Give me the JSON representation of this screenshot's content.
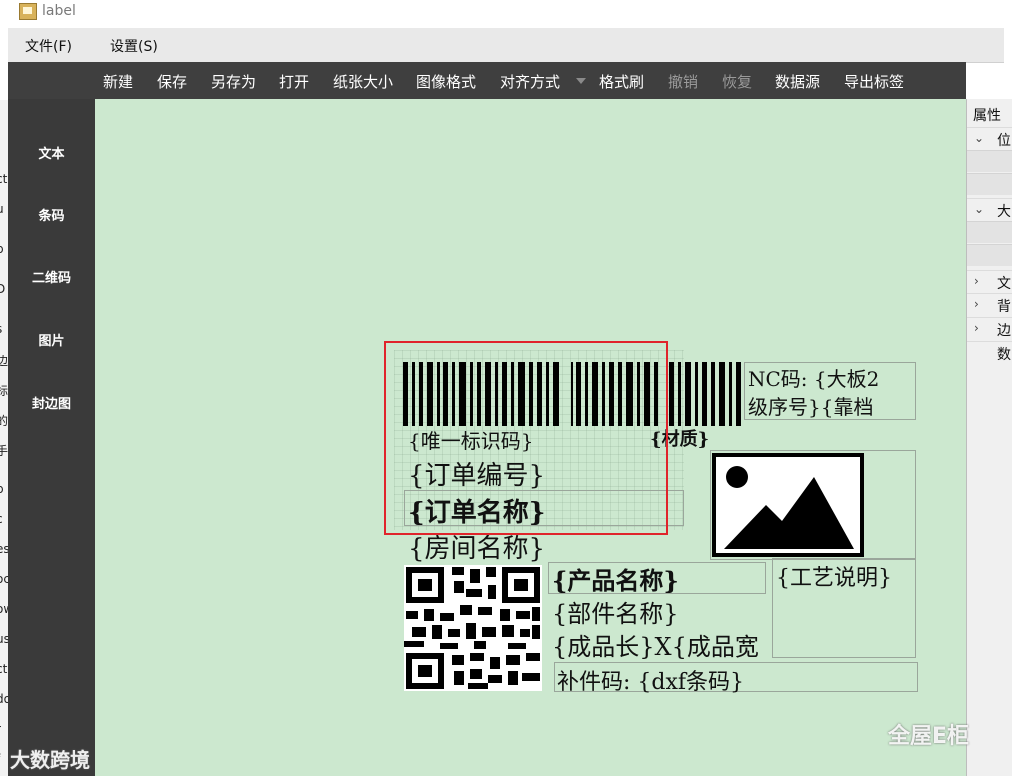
{
  "window": {
    "title": "label",
    "app_icon": "label-app-icon"
  },
  "menu": {
    "file": "文件(F)",
    "settings": "设置(S)"
  },
  "toolbar": {
    "new": "新建",
    "save": "保存",
    "save_as": "另存为",
    "open": "打开",
    "paper_size": "纸张大小",
    "image_format": "图像格式",
    "align": "对齐方式",
    "format_brush": "格式刷",
    "undo": "撤销",
    "redo": "恢复",
    "datasource": "数据源",
    "export": "导出标签"
  },
  "tools": {
    "text": "文本",
    "barcode": "条码",
    "qrcode": "二维码",
    "image": "图片",
    "edge_image": "封边图"
  },
  "left_strip": [
    "ct",
    "u",
    "p",
    "D",
    "s",
    "边",
    "标",
    "的",
    "手",
    "p",
    "c",
    "es",
    "oc",
    "ow",
    "us",
    "ct",
    "do",
    "r",
    "f"
  ],
  "properties": {
    "title": "属性",
    "sections": [
      {
        "arrow": "expanded",
        "label": "位"
      },
      {
        "arrow": "expanded",
        "label": "大"
      },
      {
        "arrow": "collapsed",
        "label": "文"
      },
      {
        "arrow": "collapsed",
        "label": "背"
      },
      {
        "arrow": "collapsed",
        "label": "边"
      },
      {
        "arrow": "none",
        "label": "数"
      }
    ]
  },
  "label": {
    "nc_line1": "NC码: {大板2",
    "nc_line2": "级序号}{靠档",
    "unique_id": "{唯一标识码}",
    "material": "{材质}",
    "order_no": "{订单编号}",
    "order_name": "{订单名称}",
    "room_name": "{房间名称}",
    "product_name": "{产品名称}",
    "part_name": "{部件名称}",
    "size": "{成品长}X{成品宽",
    "process_note": "{工艺说明}",
    "patch_code": "补件码: {dxf条码}"
  },
  "watermarks": {
    "left": "大数跨境",
    "right": "全屋E柜"
  },
  "colors": {
    "canvas": "#cce8cf",
    "toolbar": "#3f3f3f",
    "sidebar": "#3a3a3a",
    "selection": "#e0242b"
  }
}
